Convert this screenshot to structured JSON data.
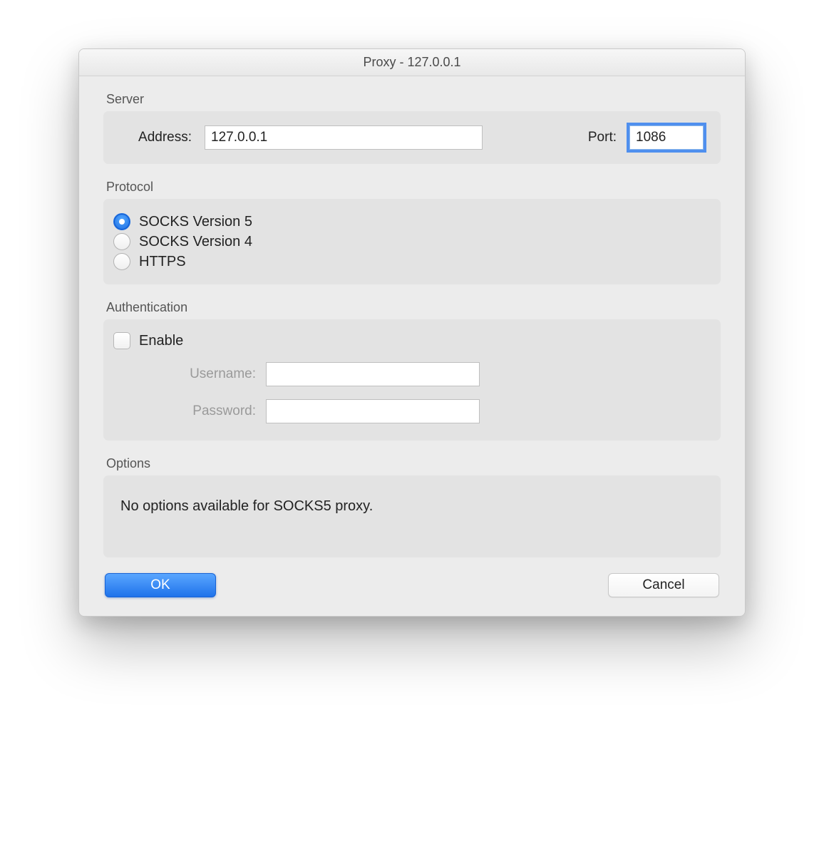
{
  "window": {
    "title": "Proxy - 127.0.0.1"
  },
  "sections": {
    "server": {
      "label": "Server",
      "address_label": "Address:",
      "address_value": "127.0.0.1",
      "port_label": "Port:",
      "port_value": "1086"
    },
    "protocol": {
      "label": "Protocol",
      "options": [
        {
          "label": "SOCKS Version 5",
          "checked": true
        },
        {
          "label": "SOCKS Version 4",
          "checked": false
        },
        {
          "label": "HTTPS",
          "checked": false
        }
      ]
    },
    "authentication": {
      "label": "Authentication",
      "enable_label": "Enable",
      "enable_checked": false,
      "username_label": "Username:",
      "username_value": "",
      "password_label": "Password:",
      "password_value": ""
    },
    "options": {
      "label": "Options",
      "message": "No options available for SOCKS5 proxy."
    }
  },
  "buttons": {
    "ok": "OK",
    "cancel": "Cancel"
  }
}
